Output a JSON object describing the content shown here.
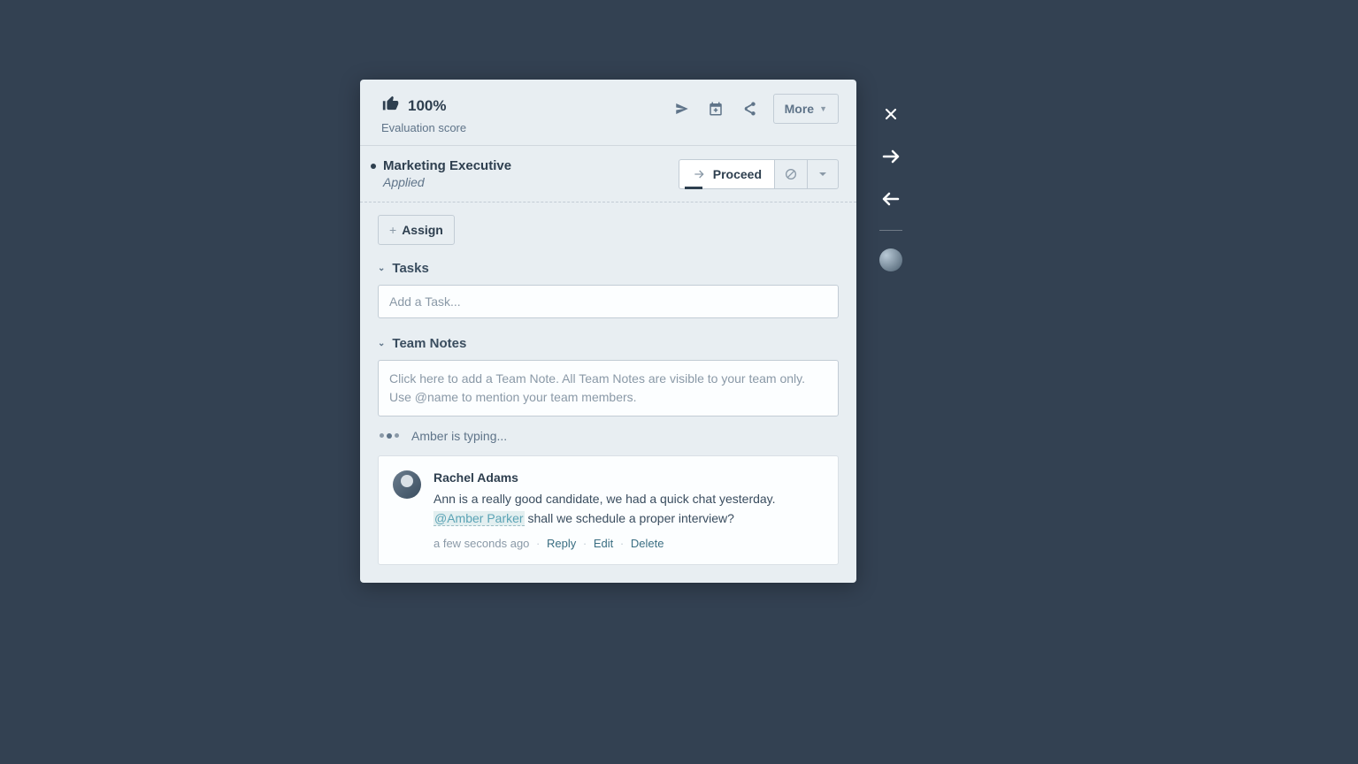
{
  "header": {
    "score_value": "100%",
    "score_label": "Evaluation score",
    "more_label": "More"
  },
  "stage": {
    "job_title": "Marketing Executive",
    "job_status": "Applied",
    "proceed_label": "Proceed"
  },
  "assign": {
    "label": "Assign"
  },
  "tasks": {
    "title": "Tasks",
    "placeholder": "Add a Task..."
  },
  "team_notes": {
    "title": "Team Notes",
    "placeholder": "Click here to add a Team Note. All Team Notes are visible to your team only. Use @name to mention your team members.",
    "typing_status": "Amber is typing..."
  },
  "note": {
    "author": "Rachel Adams",
    "text_before": "Ann is a really good candidate, we had a quick chat yesterday. ",
    "mention": "@Amber Parker",
    "text_after": " shall we schedule a proper interview?",
    "timestamp": "a few seconds ago",
    "reply": "Reply",
    "edit": "Edit",
    "delete": "Delete"
  }
}
